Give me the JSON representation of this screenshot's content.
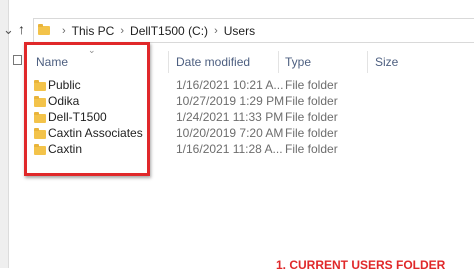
{
  "address_bar": {
    "breadcrumbs": [
      "This PC",
      "DellT1500 (C:)",
      "Users"
    ]
  },
  "columns": {
    "name": "Name",
    "date_modified": "Date modified",
    "type": "Type",
    "size": "Size"
  },
  "rows": [
    {
      "name": "Public",
      "date": "1/16/2021 10:21 A...",
      "type": "File folder",
      "size": ""
    },
    {
      "name": "Odika",
      "date": "10/27/2019 1:29 PM",
      "type": "File folder",
      "size": ""
    },
    {
      "name": "Dell-T1500",
      "date": "1/24/2021 11:33 PM",
      "type": "File folder",
      "size": ""
    },
    {
      "name": "Caxtin Associates",
      "date": "10/20/2019 7:20 AM",
      "type": "File folder",
      "size": ""
    },
    {
      "name": "Caxtin",
      "date": "1/16/2021 11:28 A...",
      "type": "File folder",
      "size": ""
    }
  ],
  "annotation": {
    "text": "1.  CURRENT USERS FOLDER"
  },
  "colors": {
    "highlight": "#e0282a",
    "folder": "#f3c34a",
    "header_text": "#4d5f80"
  },
  "icons": {
    "nav": "chevron-down-icon",
    "up": "up-arrow-icon",
    "folder": "folder-icon"
  }
}
